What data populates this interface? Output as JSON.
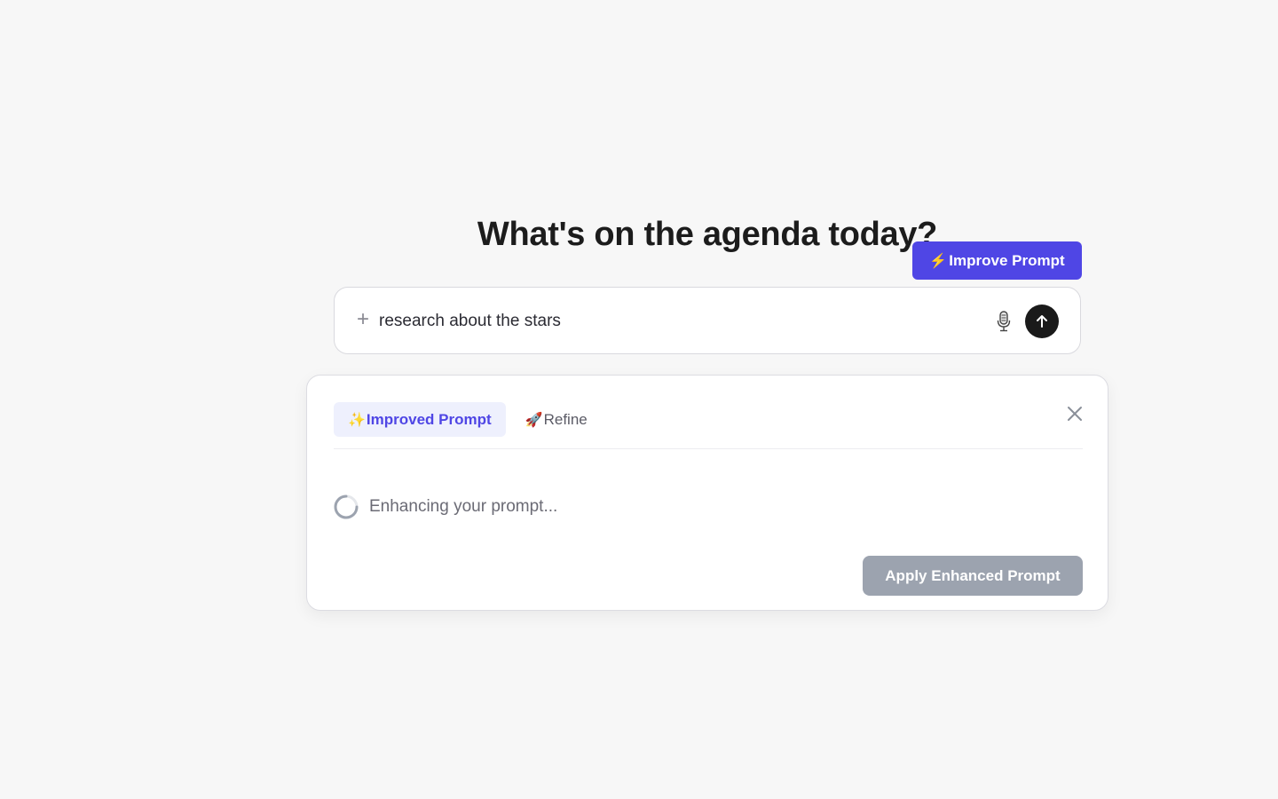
{
  "heading": "What's on the agenda today?",
  "improve_button": {
    "icon": "⚡",
    "label": "Improve Prompt",
    "color": "#4f46e5"
  },
  "composer": {
    "add_icon": "plus-icon",
    "input_value": "research about the stars",
    "mic_icon": "microphone-icon",
    "send_icon": "arrow-up-icon"
  },
  "panel": {
    "tabs": [
      {
        "icon": "✨",
        "label": "Improved Prompt",
        "active": true
      },
      {
        "icon": "🚀",
        "label": "Refine",
        "active": false
      }
    ],
    "close_icon": "close-icon",
    "loading_text": "Enhancing your prompt...",
    "apply_label": "Apply Enhanced Prompt",
    "apply_color": "#9ca3af"
  }
}
